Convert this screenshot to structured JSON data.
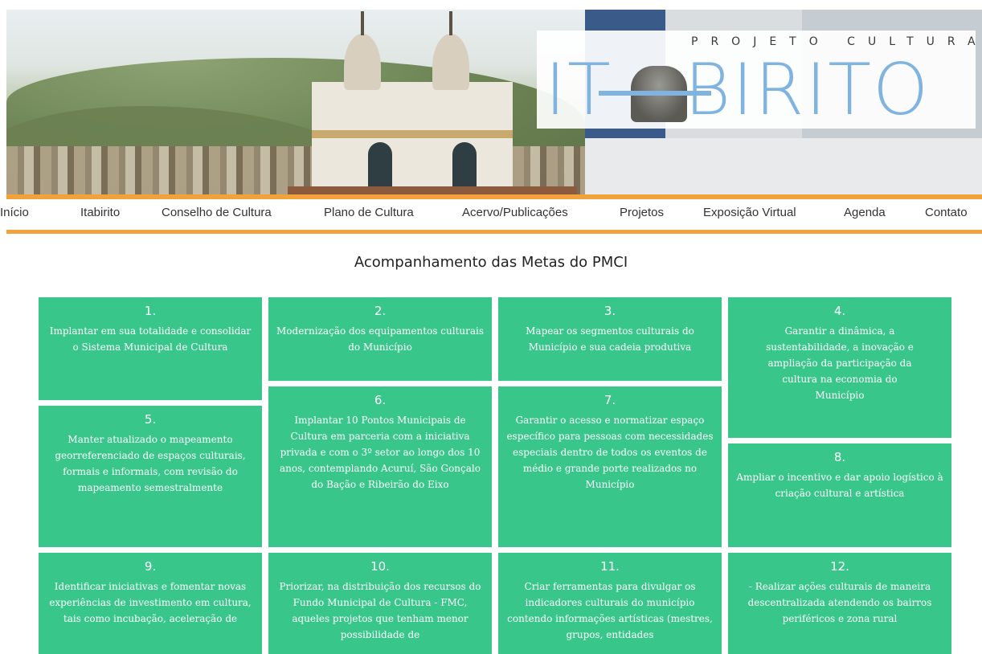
{
  "banner": {
    "logo_subtitle": "PROJETO CULTURA",
    "logo_title": "IT   BIRITO"
  },
  "nav": {
    "items": [
      "Início",
      "Itabirito",
      "Conselho de Cultura",
      "Plano de Cultura",
      "Acervo/Publicações",
      "Projetos",
      "Exposição Virtual",
      "Agenda",
      "Contato"
    ]
  },
  "page_title": "Acompanhamento das Metas do PMCI",
  "colors": {
    "accent": "#f1a23b",
    "tile": "#38c68b",
    "logo": "#7fb3e0"
  },
  "goals": [
    {
      "num": "1.",
      "text": "Implantar em sua totalidade e consolidar o Sistema Municipal de Cultura"
    },
    {
      "num": "2.",
      "text": "Modernização dos equipamentos culturais do Município"
    },
    {
      "num": "3.",
      "text": "Mapear os segmentos culturais do Município e sua cadeia produtiva"
    },
    {
      "num": "4.",
      "text": "Garantir a dinâmica, a sustentabilidade, a inovação e ampliação da participação da cultura na economia do Município"
    },
    {
      "num": "5.",
      "text": "Manter atualizado o mapeamento georreferenciado de espaços culturais, formais e informais, com revisão do mapeamento semestralmente"
    },
    {
      "num": "6.",
      "text": "Implantar 10 Pontos Municipais de Cultura em parceria com a iniciativa privada e com o 3º setor ao longo dos 10 anos, contemplando Acuruí, São Gonçalo do Bação e Ribeirão do Eixo"
    },
    {
      "num": "7.",
      "text": "Garantir o acesso e normatizar espaço específico para pessoas com necessidades especiais dentro de todos os eventos de médio e grande porte realizados no Município"
    },
    {
      "num": "8.",
      "text": "Ampliar o incentivo e dar apoio logístico à criação cultural e artística"
    },
    {
      "num": "9.",
      "text": "Identificar iniciativas e fomentar novas experiências de investimento em cultura, tais como incubação, aceleração de"
    },
    {
      "num": "10.",
      "text": "Priorizar, na distribuição dos recursos do Fundo Municipal de Cultura - FMC, aqueles projetos que tenham menor possibilidade de"
    },
    {
      "num": "11.",
      "text": "Criar ferramentas para divulgar os indicadores culturais do município contendo informações artísticas (mestres, grupos, entidades"
    },
    {
      "num": "12.",
      "text": "- Realizar ações culturais de maneira descentralizada atendendo os bairros periféricos e zona rural"
    }
  ]
}
